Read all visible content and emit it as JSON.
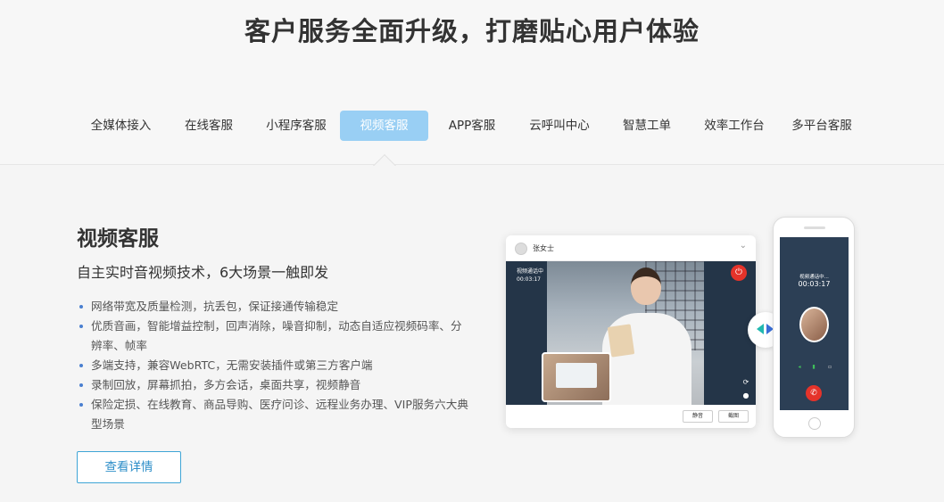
{
  "headline": "客户服务全面升级，打磨贴心用户体验",
  "tabs": [
    {
      "label": "全媒体接入"
    },
    {
      "label": "在线客服"
    },
    {
      "label": "小程序客服"
    },
    {
      "label": "视频客服",
      "active": true
    },
    {
      "label": "APP客服"
    },
    {
      "label": "云呼叫中心"
    },
    {
      "label": "智慧工单"
    },
    {
      "label": "效率工作台"
    },
    {
      "label": "多平台客服"
    }
  ],
  "section": {
    "title": "视频客服",
    "subtitle": "自主实时音视频技术，6大场景一触即发",
    "features": [
      "网络带宽及质量检测，抗丢包，保证接通传输稳定",
      "优质音画，智能增益控制，回声消除，噪音抑制，动态自适应视频码率、分辨率、帧率",
      "多端支持，兼容WebRTC，无需安装插件或第三方客户端",
      "录制回放，屏幕抓拍，多方会话，桌面共享，视频静音",
      "保险定损、在线教育、商品导购、医疗问诊、远程业务办理、VIP服务六大典型场景"
    ],
    "more_button": "查看详情"
  },
  "mockup": {
    "desktop": {
      "caller_name": "张女士",
      "status": "视频通话中",
      "timer": "00:03:17",
      "mute_button": "静音",
      "screenshot_button": "截图"
    },
    "phone": {
      "status": "视频通话中...",
      "timer": "00:03:17"
    }
  },
  "colors": {
    "active_tab": "#99cff4",
    "accent": "#3fa5d6",
    "hangup": "#e5332a"
  }
}
